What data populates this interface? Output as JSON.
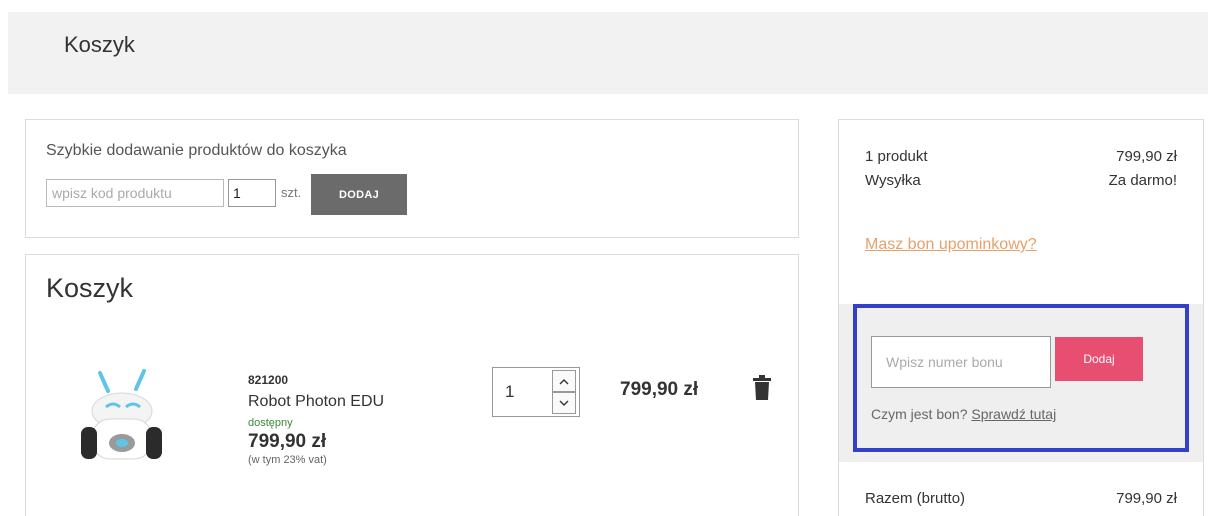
{
  "header": {
    "title": "Koszyk"
  },
  "quick_add": {
    "title": "Szybkie dodawanie produktów do koszyka",
    "code_placeholder": "wpisz kod produktu",
    "quantity": "1",
    "unit": "szt.",
    "add_label": "DODAJ"
  },
  "cart": {
    "title": "Koszyk",
    "items": [
      {
        "sku": "821200",
        "name": "Robot Photon EDU",
        "availability": "dostępny",
        "unit_price": "799,90 zł",
        "vat_note": "(w tym 23% vat)",
        "quantity": "1",
        "line_total": "799,90 zł",
        "image_icon": "robot-product-image"
      }
    ]
  },
  "summary": {
    "products_label": "1 produkt",
    "products_value": "799,90 zł",
    "shipping_label": "Wysyłka",
    "shipping_value": "Za darmo!",
    "voucher_link": "Masz bon upominkowy?",
    "voucher_placeholder": "Wpisz numer bonu",
    "voucher_add_label": "Dodaj",
    "voucher_question": "Czym jest bon?",
    "voucher_check_link": "Sprawdź tutaj",
    "total_label": "Razem (brutto)",
    "total_value": "799,90 zł"
  },
  "colors": {
    "accent_pink": "#e84d72",
    "link_orange": "#e8a06a",
    "highlight_blue": "#3540c8",
    "button_gray": "#6b6b6b",
    "available_green": "#3a8a3a"
  }
}
